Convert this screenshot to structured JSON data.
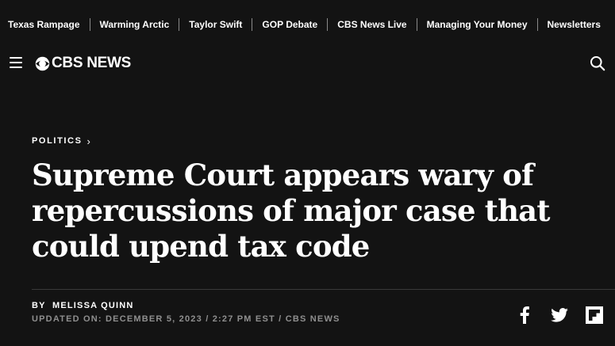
{
  "trending": {
    "items": [
      "Texas Rampage",
      "Warming Arctic",
      "Taylor Swift",
      "GOP Debate",
      "CBS News Live",
      "Managing Your Money",
      "Newsletters"
    ]
  },
  "header": {
    "logo_text": "CBS NEWS",
    "menu_icon": "hamburger-icon",
    "search_icon": "search-icon"
  },
  "article": {
    "category": "POLITICS",
    "headline": "Supreme Court appears wary of repercussions of major case that could upend tax code",
    "byline_prefix": "BY",
    "author": "MELISSA QUINN",
    "updated": "UPDATED ON: DECEMBER 5, 2023 / 2:27 PM EST / CBS NEWS"
  },
  "social": {
    "items": [
      "facebook-icon",
      "twitter-icon",
      "flipboard-icon"
    ]
  },
  "colors": {
    "background": "#131313",
    "text": "#ffffff",
    "muted": "#8f8f8f"
  }
}
